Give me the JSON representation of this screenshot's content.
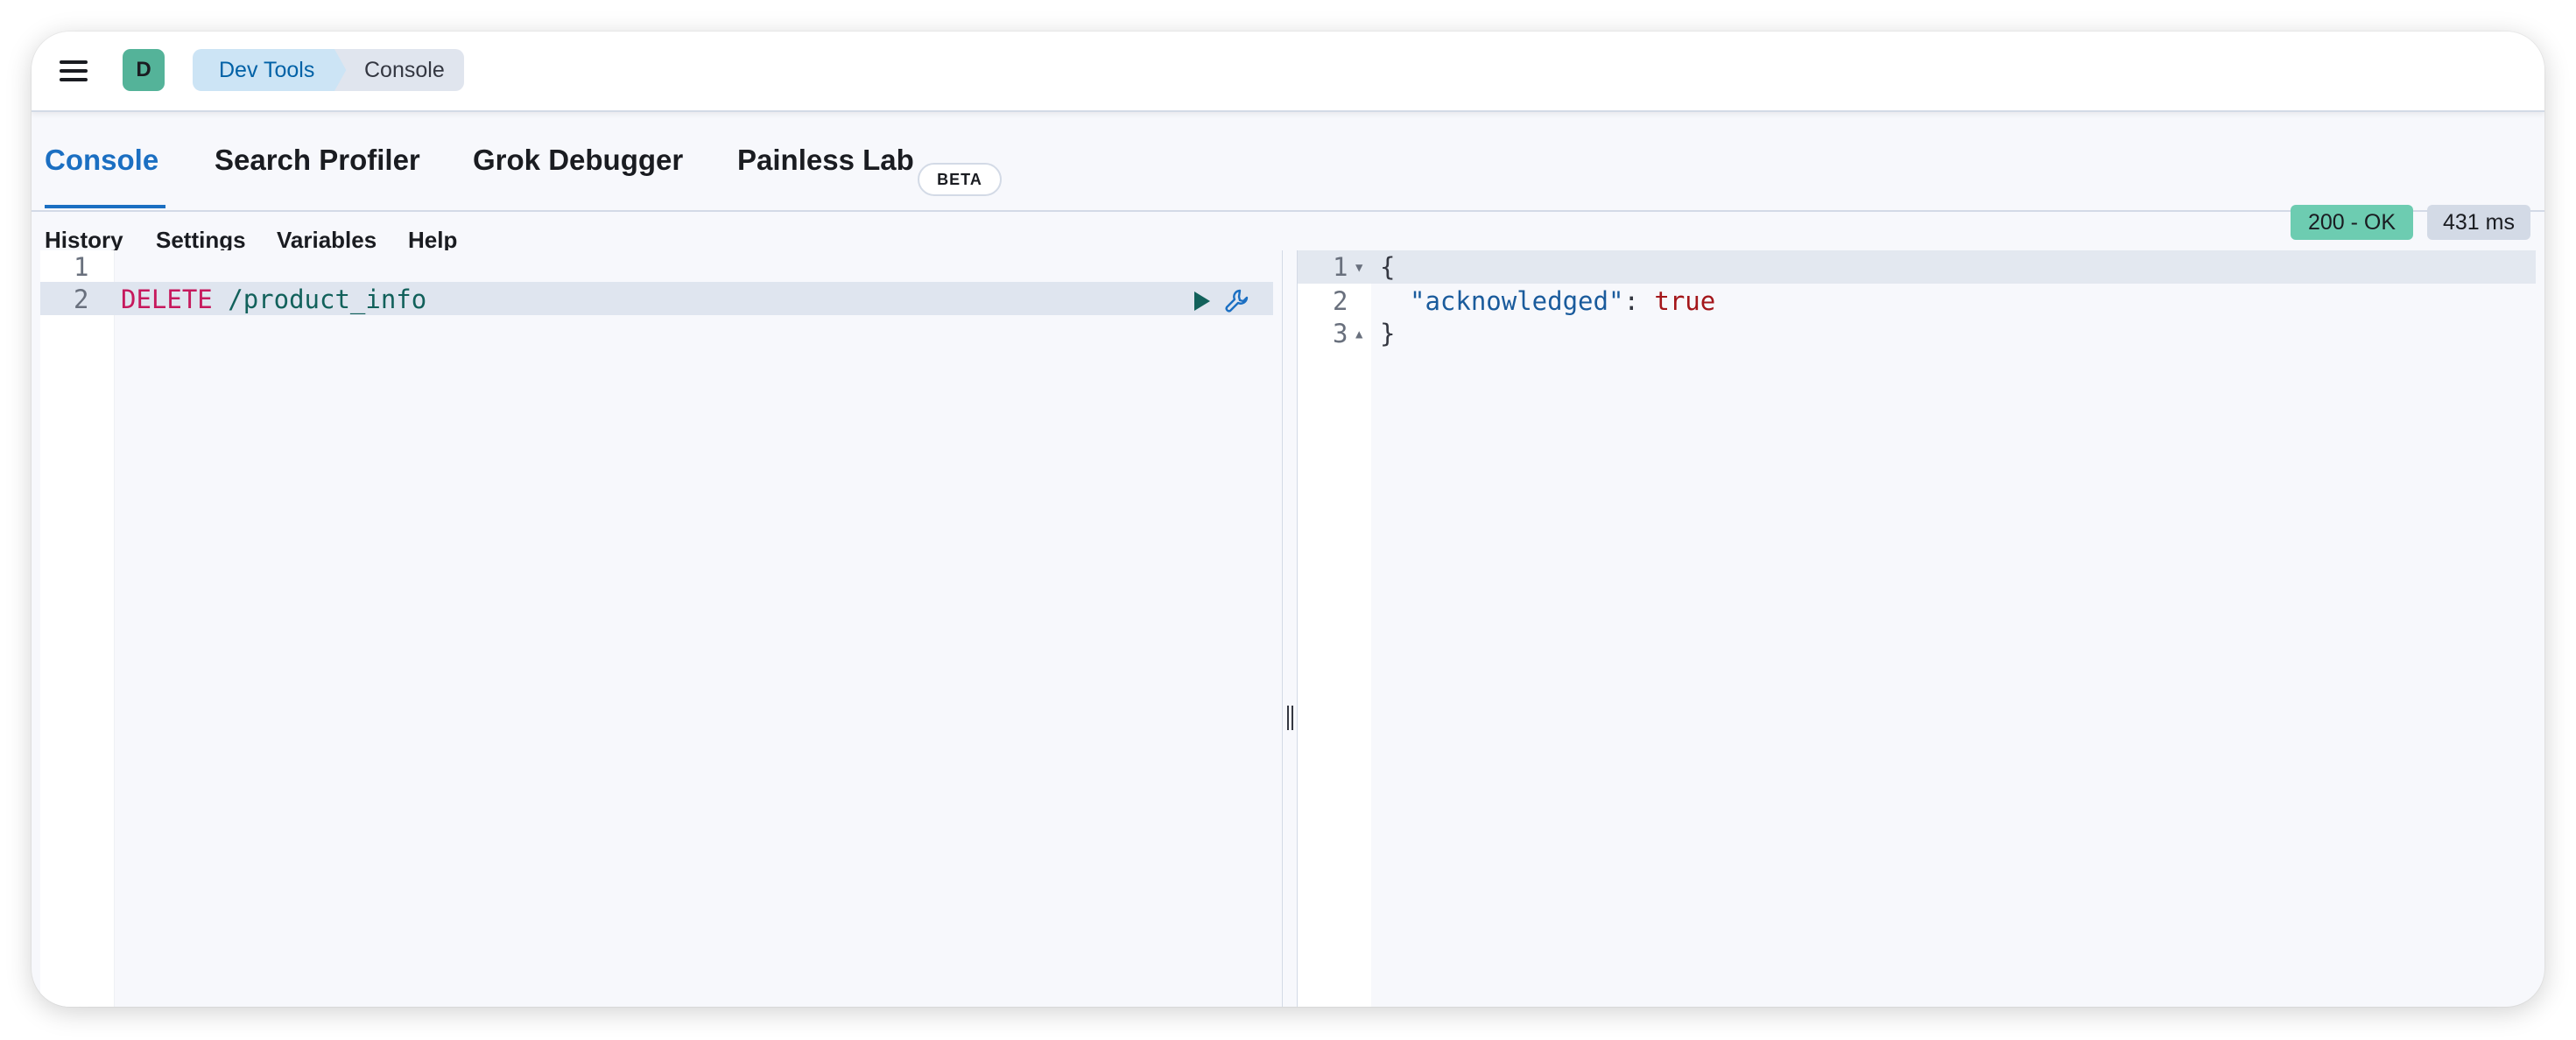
{
  "header": {
    "avatar_initial": "D",
    "breadcrumbs": [
      "Dev Tools",
      "Console"
    ]
  },
  "tabs": [
    {
      "label": "Console",
      "active": true
    },
    {
      "label": "Search Profiler",
      "active": false
    },
    {
      "label": "Grok Debugger",
      "active": false
    },
    {
      "label": "Painless Lab",
      "active": false,
      "badge": "BETA"
    }
  ],
  "toolbar": {
    "items": [
      "History",
      "Settings",
      "Variables",
      "Help"
    ],
    "status": "200 - OK",
    "duration": "431 ms"
  },
  "request_editor": {
    "line_numbers": [
      "1",
      "2"
    ],
    "method": "DELETE",
    "path": "/product_info",
    "run_icon": "play-icon",
    "wrench_icon": "wrench-icon"
  },
  "response_editor": {
    "line_numbers": [
      "1",
      "2",
      "3"
    ],
    "open_brace": "{",
    "key": "\"acknowledged\"",
    "colon": ": ",
    "value": "true",
    "close_brace": "}"
  },
  "colors": {
    "accent": "#1b6fc2",
    "status_ok": "#6dccb1",
    "method": "#c6195d",
    "path": "#12615b"
  }
}
